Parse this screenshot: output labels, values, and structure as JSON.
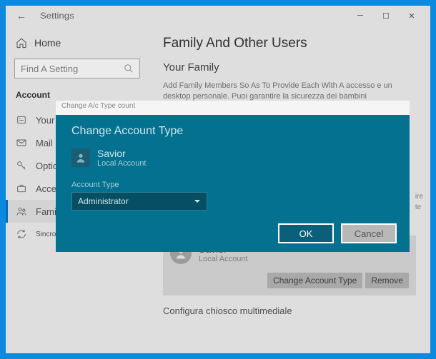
{
  "window": {
    "title": "Settings"
  },
  "sidebar": {
    "home": "Home",
    "searchPlaceholder": "Find A Setting",
    "section": "Account",
    "items": [
      {
        "label": "Your I"
      },
      {
        "label": "Mail e"
      },
      {
        "label": "Option"
      },
      {
        "label": "Access"
      },
      {
        "label": "Families"
      },
      {
        "label": "Sincronizza"
      }
    ]
  },
  "main": {
    "heading": "Family And Other Users",
    "subheading": "Your Family",
    "description1": "Add Family Members So As To Provide Each With A accesso e un desktop personale. Puoi garantire la sicurezza dei bambini",
    "rightEdge1": "ire",
    "rightEdge2": "te",
    "addSymbol": "+",
    "user": {
      "name": "Savior",
      "type": "Local Account"
    },
    "changeTypeBtn": "Change Account Type",
    "removeBtn": "Remove",
    "kiosk": "Configura chiosco multimediale"
  },
  "dialog": {
    "titlebar": "Change A/c Type    count",
    "heading": "Change Account Type",
    "user": {
      "name": "Savior",
      "type": "Local Account"
    },
    "fieldLabel": "Account Type",
    "selected": "Administrator",
    "okBtn": "OK",
    "cancelBtn": "Cancel"
  }
}
